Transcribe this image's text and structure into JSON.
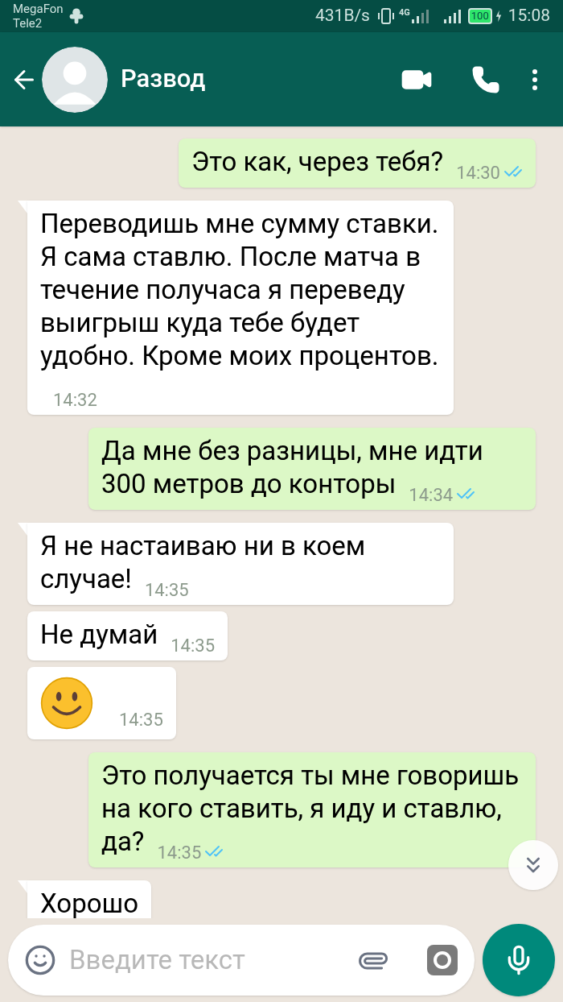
{
  "status_bar": {
    "carrier_1": "MegaFon",
    "carrier_2": "Tele2",
    "speed": "431B/s",
    "network": "4G",
    "battery": "100",
    "time": "15:08"
  },
  "header": {
    "contact_name": "Развод"
  },
  "messages": [
    {
      "kind": "out",
      "text": "Это как, через тебя?",
      "time": "14:30",
      "read": true
    },
    {
      "kind": "in",
      "text": "Переводишь мне сумму ставки. Я сама ставлю. После матча в течение получаса я переведу выигрыш куда тебе будет удобно. Кроме моих процентов.",
      "time": "14:32",
      "tail": true
    },
    {
      "kind": "out",
      "text": "Да мне без разницы, мне идти 300 метров до конторы",
      "time": "14:34",
      "read": true
    },
    {
      "kind": "in",
      "text": "Я не настаиваю ни в коем случае!",
      "time": "14:35",
      "tail": true
    },
    {
      "kind": "in",
      "text": "Не думай",
      "time": "14:35",
      "tail": false
    },
    {
      "kind": "emoji",
      "time": "14:35",
      "tail": false
    },
    {
      "kind": "out",
      "text": "Это получается ты мне говоришь на кого ставить, я иду и ставлю, да?",
      "time": "14:35",
      "read": true
    },
    {
      "kind": "in",
      "text": "Хорошо",
      "tail": true
    }
  ],
  "input": {
    "placeholder": "Введите текст"
  }
}
